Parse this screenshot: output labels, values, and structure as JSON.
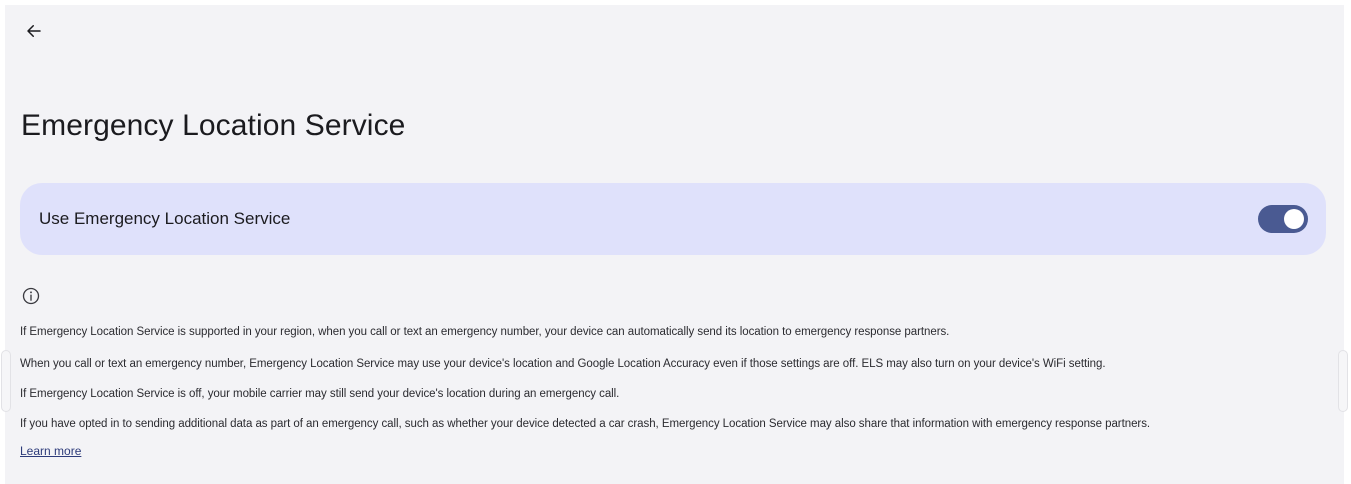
{
  "page": {
    "title": "Emergency Location Service"
  },
  "setting": {
    "label": "Use Emergency Location Service",
    "enabled": true
  },
  "info": {
    "paragraphs": [
      "If Emergency Location Service is supported in your region, when you call or text an emergency number, your device can automatically send its location to emergency response partners.",
      "When you call or text an emergency number, Emergency Location Service may use your device's location and Google Location Accuracy even if those settings are off. ELS may also turn on your device's WiFi setting.",
      "If Emergency Location Service is off, your mobile carrier may still send your device's location during an emergency call.",
      "If you have opted in to sending additional data as part of an emergency call, such as whether your device detected a car crash, Emergency Location Service may also share that information with emergency response partners."
    ],
    "learn_more": "Learn more"
  },
  "colors": {
    "background": "#f3f3f6",
    "card": "#dfe1fb",
    "toggle_on": "#4a5a92",
    "link": "#2d3b7a"
  },
  "icons": {
    "back": "arrow-back-icon",
    "info": "info-icon"
  }
}
